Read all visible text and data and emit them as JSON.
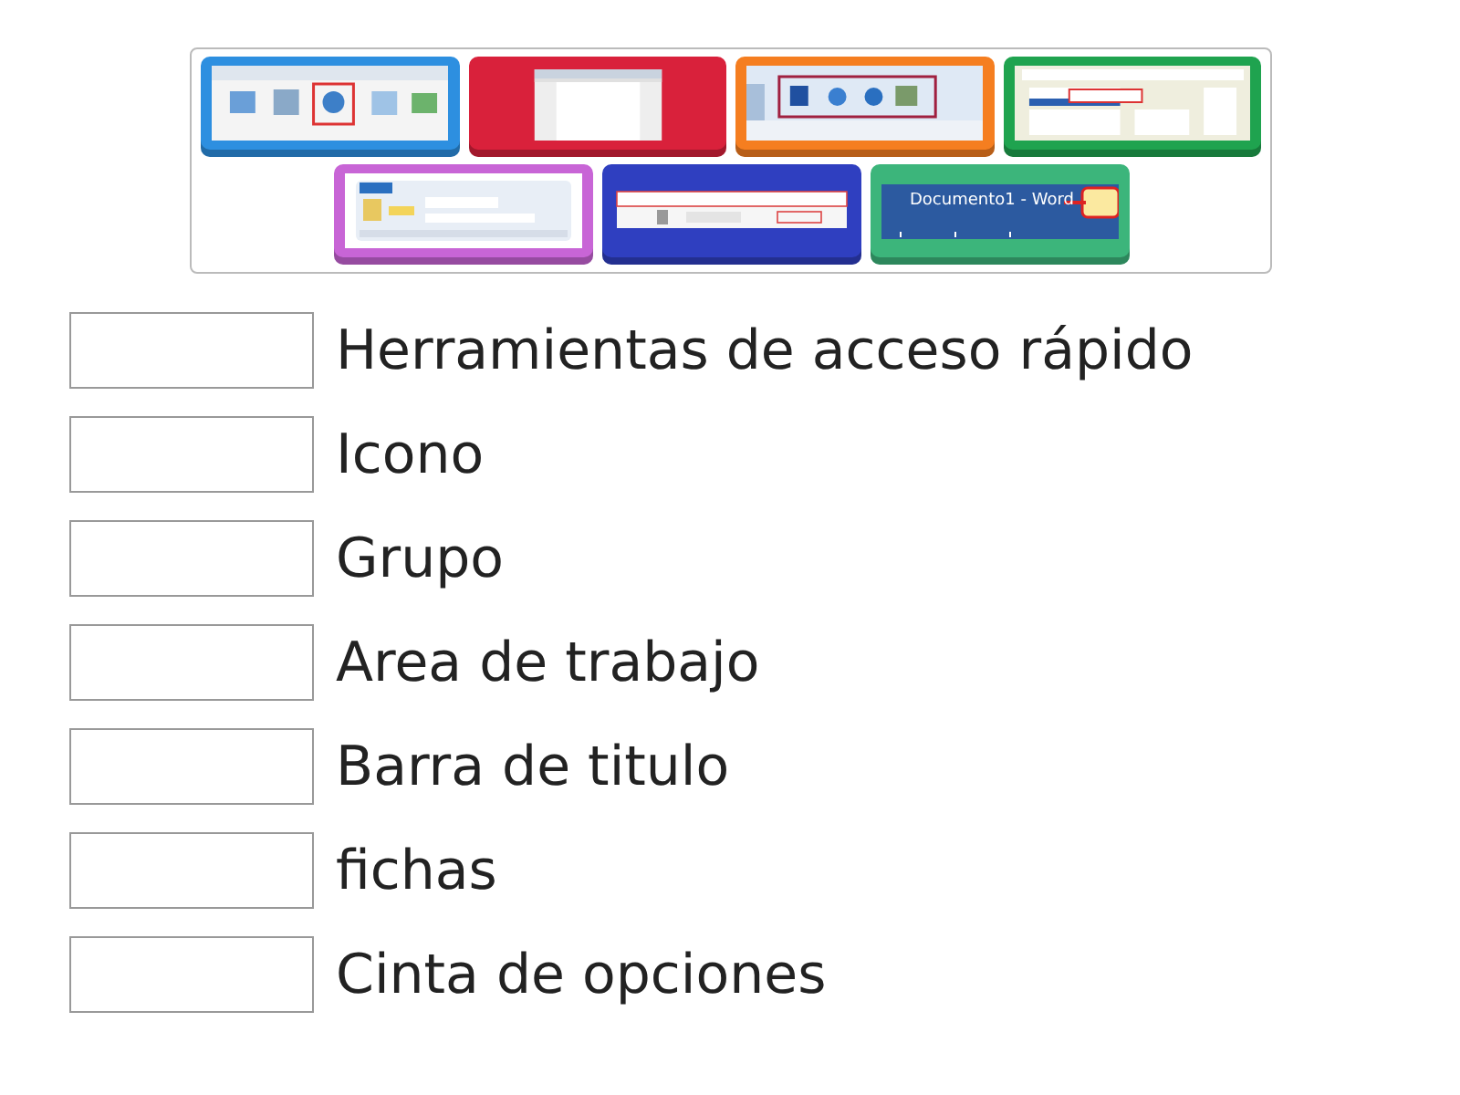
{
  "tiles": [
    {
      "kind": "picture",
      "color": "#2d8fe0"
    },
    {
      "kind": "picture",
      "color": "#d9213b"
    },
    {
      "kind": "picture",
      "color": "#f57e20"
    },
    {
      "kind": "picture",
      "color": "#1fa34f"
    },
    {
      "kind": "picture",
      "color": "#c865d6"
    },
    {
      "kind": "picture",
      "color": "#2f3fc0"
    },
    {
      "kind": "picture",
      "color": "#3cb57b",
      "caption": "Documento1 - Word"
    }
  ],
  "answers": [
    {
      "label": "Herramientas de acceso rápido"
    },
    {
      "label": "Icono"
    },
    {
      "label": "Grupo"
    },
    {
      "label": "Area de trabajo"
    },
    {
      "label": "Barra de titulo"
    },
    {
      "label": "fichas"
    },
    {
      "label": "Cinta de opciones"
    }
  ]
}
